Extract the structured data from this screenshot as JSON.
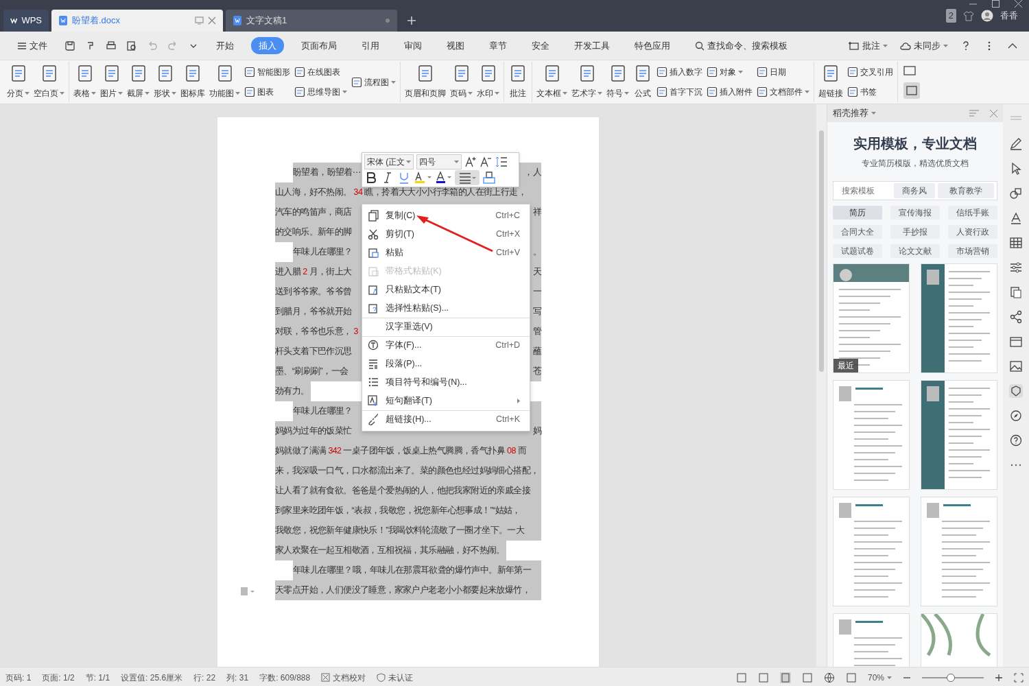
{
  "title_bar": {
    "tabs": [
      {
        "kind": "home",
        "label": "WPS",
        "selected": false
      },
      {
        "kind": "doc",
        "label": "盼望着.docx",
        "selected": true
      },
      {
        "kind": "doc",
        "label": "文字文稿1",
        "selected": false
      }
    ],
    "window_count": "2",
    "user_name": "香香"
  },
  "menu_bar": {
    "file_label": "文件",
    "tabs": [
      {
        "label": "开始",
        "selected": false
      },
      {
        "label": "插入",
        "selected": true
      },
      {
        "label": "页面布局",
        "selected": false
      },
      {
        "label": "引用",
        "selected": false
      },
      {
        "label": "审阅",
        "selected": false
      },
      {
        "label": "视图",
        "selected": false
      },
      {
        "label": "章节",
        "selected": false
      },
      {
        "label": "安全",
        "selected": false
      },
      {
        "label": "开发工具",
        "selected": false
      },
      {
        "label": "特色应用",
        "selected": false
      }
    ],
    "search_label": "查找命令、搜索模板",
    "right_items": [
      {
        "label": "批注"
      },
      {
        "label": "未同步"
      }
    ]
  },
  "ribbon": [
    {
      "items": [
        {
          "kind": "large",
          "label": "分页",
          "caret": true
        },
        {
          "kind": "large",
          "label": "空白页",
          "caret": true
        }
      ]
    },
    {
      "items": [
        {
          "kind": "large",
          "label": "表格",
          "caret": true
        },
        {
          "kind": "large",
          "label": "图片",
          "caret": true
        },
        {
          "kind": "large",
          "label": "截屏",
          "caret": true
        },
        {
          "kind": "large",
          "label": "形状",
          "caret": true
        },
        {
          "kind": "large",
          "label": "图标库",
          "caret": false
        },
        {
          "kind": "large",
          "label": "功能图",
          "caret": true
        },
        {
          "kind": "stack",
          "entries": [
            {
              "label": "智能图形",
              "caret": false
            },
            {
              "label": "图表",
              "caret": false
            }
          ]
        },
        {
          "kind": "stack",
          "entries": [
            {
              "label": "在线图表",
              "caret": false
            },
            {
              "label": "思维导图",
              "caret": true
            }
          ]
        },
        {
          "kind": "stack",
          "entries": [
            {
              "label": "流程图",
              "caret": true
            }
          ]
        }
      ]
    },
    {
      "items": [
        {
          "kind": "large",
          "label": "页眉和页脚",
          "caret": false
        },
        {
          "kind": "large",
          "label": "页码",
          "caret": true
        },
        {
          "kind": "large",
          "label": "水印",
          "caret": true
        }
      ]
    },
    {
      "items": [
        {
          "kind": "large",
          "label": "批注",
          "caret": false
        }
      ]
    },
    {
      "items": [
        {
          "kind": "large",
          "label": "文本框",
          "caret": true
        },
        {
          "kind": "large",
          "label": "艺术字",
          "caret": true
        },
        {
          "kind": "large",
          "label": "符号",
          "caret": true
        },
        {
          "kind": "large",
          "label": "公式",
          "caret": false
        },
        {
          "kind": "stack",
          "entries": [
            {
              "label": "插入数字",
              "caret": false
            },
            {
              "label": "首字下沉",
              "caret": false
            }
          ]
        },
        {
          "kind": "stack",
          "entries": [
            {
              "label": "对象",
              "caret": true
            },
            {
              "label": "插入附件",
              "caret": false
            }
          ]
        },
        {
          "kind": "stack",
          "entries": [
            {
              "label": "日期",
              "caret": false
            },
            {
              "label": "文档部件",
              "caret": true
            }
          ]
        }
      ]
    },
    {
      "items": [
        {
          "kind": "large",
          "label": "超链接",
          "caret": false
        },
        {
          "kind": "stack",
          "entries": [
            {
              "label": "交叉引用",
              "caret": false
            },
            {
              "label": "书签",
              "caret": false
            }
          ]
        }
      ]
    }
  ],
  "document": {
    "lines": [
      {
        "indent": true,
        "segments": [
          {
            "text": "盼望着，盼望着⋯"
          }
        ],
        "right": "，人"
      },
      {
        "indent": false,
        "segments": [
          {
            "text": "山人海，好不热闹。"
          },
          {
            "kind": "number",
            "text": "34"
          },
          {
            "text": "瞧，拎着大大小小行李箱的人在街上行走，"
          }
        ]
      },
      {
        "indent": false,
        "segments": [
          {
            "text": "汽车的鸣笛声，商店"
          }
        ],
        "right": "祥"
      },
      {
        "indent": false,
        "segments": [
          {
            "text": "的交响乐。新年的脚"
          }
        ]
      },
      {
        "indent": true,
        "segments": [
          {
            "text": "年味儿在哪里？"
          }
        ],
        "right": "。"
      },
      {
        "indent": false,
        "segments": [
          {
            "text": "进入腊"
          },
          {
            "kind": "number",
            "text": "2"
          },
          {
            "text": "月，街上大"
          }
        ],
        "right": "天"
      },
      {
        "indent": false,
        "segments": [
          {
            "text": "送到爷爷家。爷爷曾"
          }
        ],
        "right": "一"
      },
      {
        "indent": false,
        "segments": [
          {
            "text": "到腊月，爷爷就开始"
          }
        ],
        "right": "写"
      },
      {
        "indent": false,
        "segments": [
          {
            "text": "对联，爷爷也乐意，"
          },
          {
            "kind": "number",
            "text": "3"
          }
        ],
        "right": "管"
      },
      {
        "indent": false,
        "segments": [
          {
            "text": "杆头支着下巴作沉思"
          }
        ],
        "right": "蘸"
      },
      {
        "indent": false,
        "segments": [
          {
            "text": "墨、“刷刷刷”，一会"
          }
        ],
        "right": "苍"
      },
      {
        "indent": false,
        "paragraph_end": true,
        "segments": [
          {
            "text": "劲有力。"
          }
        ]
      },
      {
        "indent": true,
        "segments": [
          {
            "text": "年味儿在哪里？"
          }
        ]
      },
      {
        "indent": false,
        "segments": [
          {
            "text": "妈妈为过年的饭菜忙"
          }
        ],
        "right": "妈"
      },
      {
        "indent": false,
        "segments": [
          {
            "text": "妈就做了满满"
          },
          {
            "kind": "number",
            "text": "342"
          },
          {
            "text": "一桌子团年饭，饭桌上热气腾腾，香气扑鼻"
          },
          {
            "kind": "number",
            "text": "08"
          },
          {
            "text": "而"
          }
        ]
      },
      {
        "indent": false,
        "segments": [
          {
            "text": "来，我深吸一口气，口水都流出来了。菜的颜色也经过妈妈细心搭配，"
          }
        ]
      },
      {
        "indent": false,
        "segments": [
          {
            "text": "让人看了就有食欲。爸爸是个爱热闹的人，他把我家附近的亲戚全接"
          }
        ]
      },
      {
        "indent": false,
        "segments": [
          {
            "text": "到家里来吃团年饭，“表叔，我敬您，祝您新年心想事成！”“姑姑，"
          }
        ]
      },
      {
        "indent": false,
        "segments": [
          {
            "text": "我敬您，祝您新年健康快乐！”我喝饮料轮流敬了一圈才坐下。一大"
          }
        ]
      },
      {
        "indent": false,
        "paragraph_end": true,
        "segments": [
          {
            "text": "家人欢聚在一起互相敬酒，互相祝福，其乐融融，好不热闹。"
          }
        ]
      },
      {
        "indent": true,
        "segments": [
          {
            "text": "年味儿在哪里？哦，年味儿在那震耳欲聋的爆竹声中。新年第一"
          }
        ]
      },
      {
        "indent": false,
        "segments": [
          {
            "text": "天零点开始，人们便没了睡意，家家户户老老小小都要起来放爆竹，"
          }
        ]
      }
    ]
  },
  "mini_toolbar": {
    "font": "宋体 (正文",
    "size": "四号",
    "align_selected": true
  },
  "context_menu": [
    {
      "label": "复制(C)",
      "shortcut": "Ctrl+C",
      "disabled": false
    },
    {
      "label": "剪切(T)",
      "shortcut": "Ctrl+X",
      "disabled": false
    },
    {
      "label": "粘贴",
      "shortcut": "Ctrl+V",
      "disabled": false
    },
    {
      "label": "带格式粘贴(K)",
      "disabled": true
    },
    {
      "label": "只粘贴文本(T)",
      "disabled": false
    },
    {
      "label": "选择性粘贴(S)...",
      "disabled": false
    },
    {
      "label": "汉字重选(V)",
      "disabled": false,
      "separator_before": true
    },
    {
      "label": "字体(F)...",
      "shortcut": "Ctrl+D",
      "disabled": false,
      "separator_before": true
    },
    {
      "label": "段落(P)...",
      "disabled": false
    },
    {
      "label": "项目符号和编号(N)...",
      "disabled": false
    },
    {
      "label": "短句翻译(T)",
      "disabled": false,
      "submenu": true
    },
    {
      "label": "超链接(H)...",
      "shortcut": "Ctrl+K",
      "disabled": false,
      "separator_before": true
    }
  ],
  "side_panel": {
    "header": "稻壳推荐",
    "title": "实用模板，专业文档",
    "subtitle": "专业简历模版，精选优质文档",
    "search_placeholder": "搜索模板",
    "quick_tags": [
      "商务风",
      "教育教学"
    ],
    "categories": [
      {
        "label": "简历",
        "selected": true
      },
      {
        "label": "宣传海报",
        "selected": false
      },
      {
        "label": "信纸手账",
        "selected": false
      },
      {
        "label": "合同大全",
        "selected": false
      },
      {
        "label": "手抄报",
        "selected": false
      },
      {
        "label": "人资行政",
        "selected": false
      },
      {
        "label": "试题试卷",
        "selected": false
      },
      {
        "label": "论文文献",
        "selected": false
      },
      {
        "label": "市场营销",
        "selected": false
      }
    ],
    "templates": [
      {
        "kind": "banner",
        "tag": "最近"
      },
      {
        "kind": "sidebar"
      },
      {
        "kind": "plain"
      },
      {
        "kind": "sidebar"
      },
      {
        "kind": "plain"
      },
      {
        "kind": "plain"
      },
      {
        "kind": "plain"
      },
      {
        "kind": "floral"
      }
    ]
  },
  "status_bar": {
    "items": [
      {
        "label": "页码: 1"
      },
      {
        "label": "页面: 1/2"
      },
      {
        "label": "节: 1/1"
      },
      {
        "label": "设置值: 25.6厘米"
      },
      {
        "label": "行: 22"
      },
      {
        "label": "列: 31"
      },
      {
        "label": "字数: 609/888"
      },
      {
        "label": "文档校对",
        "kind": "proofread"
      },
      {
        "label": "未认证",
        "kind": "certification"
      }
    ],
    "zoom": "70%",
    "zoom_slider": {
      "level": 0.47
    }
  }
}
